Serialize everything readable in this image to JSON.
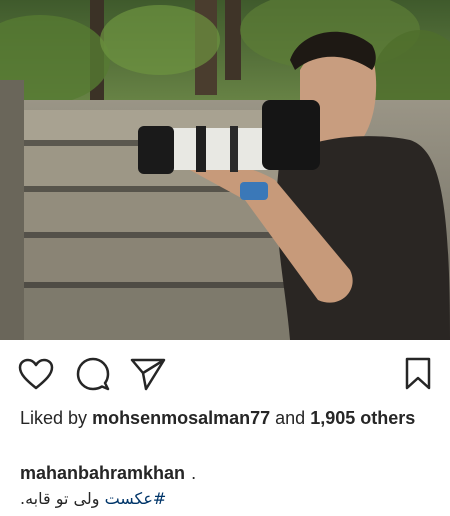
{
  "post": {
    "image_alt": "Man in black t-shirt holding a camera with a telephoto lens on stone steps in a forest",
    "icons": {
      "like": "heart-icon",
      "comment": "comment-bubble-icon",
      "share": "paper-plane-icon",
      "save": "bookmark-icon"
    },
    "likes": {
      "prefix": "Liked by",
      "user": "mohsenmosalman77",
      "conjunction": "and",
      "count": "1,905",
      "suffix": "others"
    },
    "caption": {
      "username": "mahanbahramkhan",
      "dot": ".",
      "hashtag": "#عکست",
      "text": "ولی تو قابه."
    }
  }
}
